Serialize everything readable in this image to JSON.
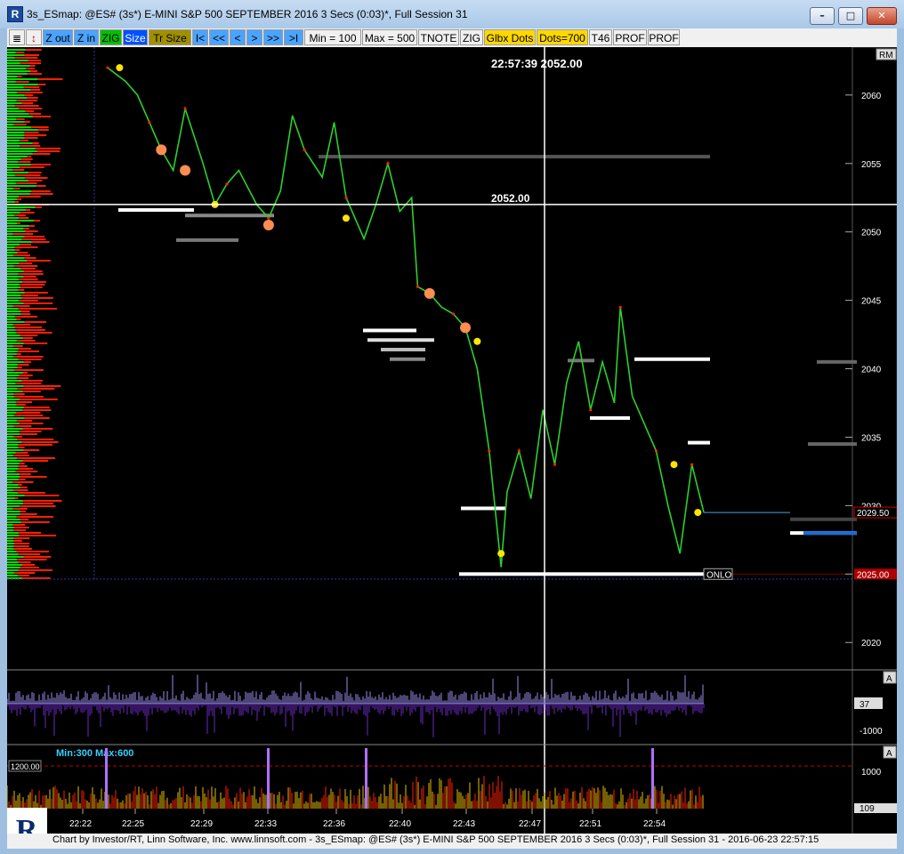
{
  "window": {
    "title": "3s_ESmap: @ES# (3s*) E-MINI S&P 500 SEPTEMBER 2016 3 Secs (0:03)*, Full Session 31",
    "app_icon_letter": "R",
    "minimize": "–",
    "restore": "□",
    "close": "✕"
  },
  "toolbar": {
    "buttons": [
      {
        "label": "≣",
        "bg": "#f0f0f0",
        "fg": "#000"
      },
      {
        "label": "↕",
        "bg": "#f0f0f0",
        "fg": "#c00000"
      },
      {
        "label": "Z out",
        "bg": "#4aa3ff",
        "fg": "#000"
      },
      {
        "label": "Z in",
        "bg": "#4aa3ff",
        "fg": "#000"
      },
      {
        "label": "ZIG",
        "bg": "#00c000",
        "fg": "#000"
      },
      {
        "label": "Size",
        "bg": "#0050ff",
        "fg": "#fff"
      },
      {
        "label": "Tr Size",
        "bg": "#a09000",
        "fg": "#000"
      },
      {
        "label": "I<",
        "bg": "#4aa3ff",
        "fg": "#000"
      },
      {
        "label": "<<",
        "bg": "#4aa3ff",
        "fg": "#000"
      },
      {
        "label": "<",
        "bg": "#4aa3ff",
        "fg": "#000"
      },
      {
        "label": ">",
        "bg": "#4aa3ff",
        "fg": "#000"
      },
      {
        "label": ">>",
        "bg": "#4aa3ff",
        "fg": "#000"
      },
      {
        "label": ">I",
        "bg": "#4aa3ff",
        "fg": "#000"
      },
      {
        "label": "Min = 100",
        "bg": "#f0f0f0",
        "fg": "#000"
      },
      {
        "label": "Max = 500",
        "bg": "#f0f0f0",
        "fg": "#000"
      },
      {
        "label": "TNOTE",
        "bg": "#f0f0f0",
        "fg": "#000"
      },
      {
        "label": "ZIG",
        "bg": "#f0f0f0",
        "fg": "#000"
      },
      {
        "label": "Glbx Dots",
        "bg": "#ffd800",
        "fg": "#000"
      },
      {
        "label": "Dots=700",
        "bg": "#ffd800",
        "fg": "#000"
      },
      {
        "label": "T46",
        "bg": "#f0f0f0",
        "fg": "#000"
      },
      {
        "label": "PROF",
        "bg": "#f0f0f0",
        "fg": "#000"
      },
      {
        "label": "PROF",
        "bg": "#f0f0f0",
        "fg": "#000"
      }
    ]
  },
  "chart_data": {
    "type": "line",
    "symbol": "@ES#",
    "crosshair": {
      "time": "22:57:39",
      "price": 2052.0,
      "readout": "22:57:39 2052.00",
      "label": "2052.00"
    },
    "price_axis": {
      "ticks": [
        "2060",
        "2055",
        "2050",
        "2045",
        "2040",
        "2035",
        "2030",
        "2025",
        "2020"
      ],
      "range": [
        2018.0,
        2063.5
      ],
      "last_price": "2029.50",
      "onlo_price": "2025.00",
      "onlo_label": "ONLO",
      "rm_label": "RM"
    },
    "time_axis": {
      "ticks": [
        "22:22",
        "22:25",
        "22:29",
        "22:33",
        "22:36",
        "22:40",
        "22:43",
        "22:47",
        "22:51",
        "22:54"
      ]
    },
    "price_series": [
      {
        "t": 0.0,
        "p": 2062.0
      },
      {
        "t": 0.03,
        "p": 2061.0
      },
      {
        "t": 0.05,
        "p": 2060.0
      },
      {
        "t": 0.07,
        "p": 2058.0
      },
      {
        "t": 0.09,
        "p": 2056.0
      },
      {
        "t": 0.11,
        "p": 2054.5
      },
      {
        "t": 0.13,
        "p": 2059.0
      },
      {
        "t": 0.16,
        "p": 2055.0
      },
      {
        "t": 0.18,
        "p": 2052.0
      },
      {
        "t": 0.2,
        "p": 2053.5
      },
      {
        "t": 0.22,
        "p": 2054.5
      },
      {
        "t": 0.25,
        "p": 2052.0
      },
      {
        "t": 0.27,
        "p": 2051.0
      },
      {
        "t": 0.29,
        "p": 2053.0
      },
      {
        "t": 0.31,
        "p": 2058.5
      },
      {
        "t": 0.33,
        "p": 2056.0
      },
      {
        "t": 0.36,
        "p": 2054.0
      },
      {
        "t": 0.38,
        "p": 2058.0
      },
      {
        "t": 0.4,
        "p": 2052.5
      },
      {
        "t": 0.43,
        "p": 2049.5
      },
      {
        "t": 0.45,
        "p": 2052.0
      },
      {
        "t": 0.47,
        "p": 2055.0
      },
      {
        "t": 0.49,
        "p": 2051.5
      },
      {
        "t": 0.51,
        "p": 2052.5
      },
      {
        "t": 0.52,
        "p": 2046.0
      },
      {
        "t": 0.54,
        "p": 2045.5
      },
      {
        "t": 0.56,
        "p": 2044.5
      },
      {
        "t": 0.58,
        "p": 2044.0
      },
      {
        "t": 0.6,
        "p": 2043.0
      },
      {
        "t": 0.62,
        "p": 2040.0
      },
      {
        "t": 0.64,
        "p": 2034.0
      },
      {
        "t": 0.66,
        "p": 2025.5
      },
      {
        "t": 0.67,
        "p": 2031.0
      },
      {
        "t": 0.69,
        "p": 2034.0
      },
      {
        "t": 0.71,
        "p": 2030.5
      },
      {
        "t": 0.73,
        "p": 2037.0
      },
      {
        "t": 0.75,
        "p": 2033.0
      },
      {
        "t": 0.77,
        "p": 2039.0
      },
      {
        "t": 0.79,
        "p": 2042.0
      },
      {
        "t": 0.81,
        "p": 2037.0
      },
      {
        "t": 0.83,
        "p": 2040.5
      },
      {
        "t": 0.85,
        "p": 2037.5
      },
      {
        "t": 0.86,
        "p": 2044.5
      },
      {
        "t": 0.88,
        "p": 2038.0
      },
      {
        "t": 0.9,
        "p": 2036.0
      },
      {
        "t": 0.92,
        "p": 2034.0
      },
      {
        "t": 0.94,
        "p": 2030.0
      },
      {
        "t": 0.96,
        "p": 2026.5
      },
      {
        "t": 0.98,
        "p": 2033.0
      },
      {
        "t": 1.0,
        "p": 2029.5
      }
    ],
    "volume_panel": {
      "ticks": [
        "37",
        "-1000"
      ],
      "scale_label": "A"
    },
    "tick_panel": {
      "label": "Min:300 Max:600",
      "threshold": "1200.00",
      "ticks": [
        "1000",
        "109"
      ],
      "scale_label": "A"
    },
    "colors": {
      "price_line": "#2bd12b",
      "up": "#00e000",
      "down": "#ff2000",
      "background": "#000000",
      "crosshair": "#ffffff",
      "dots_yellow": "#ffe600",
      "dots_orange": "#ff8c50"
    }
  },
  "status": {
    "text": "Chart by Investor/RT, Linn Software, Inc. www.linnsoft.com - 3s_ESmap: @ES# (3s*) E-MINI S&P 500 SEPTEMBER 2016 3 Secs (0:03)*, Full Session 31 - 2016-06-23 22:57:15"
  },
  "logo": {
    "letter": "R"
  }
}
